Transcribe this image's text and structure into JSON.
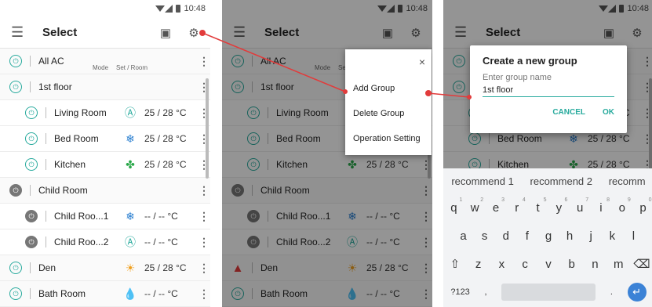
{
  "status_bar": {
    "time": "10:48"
  },
  "app_bar": {
    "title": "Select"
  },
  "columns": {
    "mode": "Mode",
    "set_room": "Set / Room"
  },
  "rows": [
    {
      "level": "group",
      "power": "on",
      "name": "All AC",
      "icon": "",
      "value": ""
    },
    {
      "level": "group",
      "power": "on",
      "name": "1st floor",
      "icon": "",
      "value": ""
    },
    {
      "level": "child",
      "power": "on",
      "name": "Living Room",
      "icon": "auto-mode-icon",
      "value": "25 / 28 °C"
    },
    {
      "level": "child",
      "power": "on",
      "name": "Bed Room",
      "icon": "cool-mode-icon",
      "value": "25 / 28 °C"
    },
    {
      "level": "child",
      "power": "on",
      "name": "Kitchen",
      "icon": "fan-mode-icon",
      "value": "25 / 28 °C"
    },
    {
      "level": "group",
      "power": "off",
      "name": "Child Room",
      "icon": "",
      "value": ""
    },
    {
      "level": "child",
      "power": "off",
      "name": "Child Roo...1",
      "icon": "cool-mode-icon",
      "value": "-- / --  °C"
    },
    {
      "level": "child",
      "power": "off",
      "name": "Child Roo...2",
      "icon": "auto-mode-icon",
      "value": "-- / --  °C"
    },
    {
      "level": "group",
      "power": "on",
      "name": "Den",
      "icon": "heat-mode-icon",
      "value": "25 / 28 °C"
    },
    {
      "level": "group",
      "power": "on",
      "name": "Bath Room",
      "icon": "dry-mode-icon",
      "value": "-- / --  °C"
    }
  ],
  "popup_menu": {
    "items": [
      "Add Group",
      "Delete Group",
      "Operation Setting"
    ],
    "close": "×"
  },
  "dialog": {
    "title": "Create a new group",
    "placeholder": "Enter group name",
    "value": "1st floor",
    "cancel": "CANCEL",
    "ok": "OK"
  },
  "keyboard": {
    "suggestions": [
      "recommend 1",
      "recommend 2",
      "recomm"
    ],
    "row1": [
      "q",
      "w",
      "e",
      "r",
      "t",
      "y",
      "u",
      "i",
      "o",
      "p"
    ],
    "row1_nums": [
      "1",
      "2",
      "3",
      "4",
      "5",
      "6",
      "7",
      "8",
      "9",
      "0"
    ],
    "row2": [
      "a",
      "s",
      "d",
      "f",
      "g",
      "h",
      "j",
      "k",
      "l"
    ],
    "row3": [
      "z",
      "x",
      "c",
      "v",
      "b",
      "n",
      "m"
    ],
    "symbols": "?123",
    "comma": ",",
    "period": "."
  },
  "colors": {
    "accent": "#27aa9d",
    "annotation": "#e23b3b",
    "off": "#777777"
  }
}
